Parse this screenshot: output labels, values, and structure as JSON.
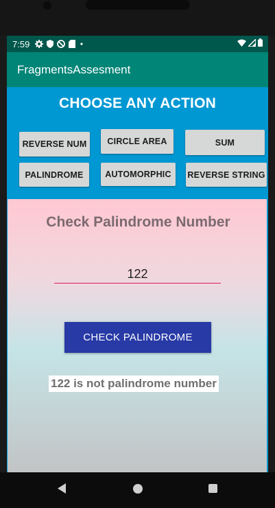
{
  "status_bar": {
    "time": "7:59",
    "icons": [
      "gear-icon",
      "shield-icon",
      "no-sync-icon",
      "sd-card-icon",
      "dot-icon"
    ],
    "right_icons": [
      "wifi-icon",
      "signal-icon",
      "battery-icon"
    ]
  },
  "app": {
    "title": "FragmentsAssesment",
    "toolbar_color": "#008577",
    "status_color": "#00574b"
  },
  "actions": {
    "title": "CHOOSE ANY ACTION",
    "panel_color": "#0098d3",
    "buttons": [
      {
        "label": "REVERSE NUM"
      },
      {
        "label": "CIRCLE AREA"
      },
      {
        "label": "SUM"
      },
      {
        "label": "PALINDROME"
      },
      {
        "label": "AUTOMORPHIC"
      },
      {
        "label": "REVERSE STRING"
      }
    ]
  },
  "fragment": {
    "title": "Check Palindrome Number",
    "input_value": "122",
    "button_label": "CHECK PALINDROME",
    "button_color": "#283aa6",
    "result": "122 is not palindrome number"
  },
  "nav": {
    "icons": [
      "back-icon",
      "home-icon",
      "recents-icon"
    ]
  }
}
